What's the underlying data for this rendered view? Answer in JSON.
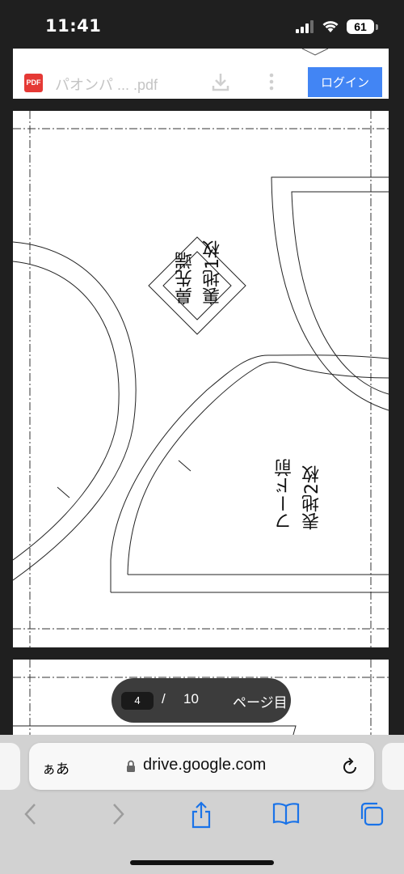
{
  "status_bar": {
    "time": "11:41",
    "battery": "61",
    "icons": [
      "signal-icon",
      "wifi-icon",
      "battery-icon"
    ]
  },
  "pdf_viewer": {
    "badge": "PDF",
    "file_name": "パオンパ ... .pdf",
    "login_label": "ログイン",
    "icons": [
      "download-icon",
      "more-icon"
    ],
    "accent_color": "#4285f4",
    "badge_color": "#e53935"
  },
  "pattern_page": {
    "labels": {
      "nose_tip": "鼻先端",
      "nose_tip_count": "裏地1枚",
      "hood_front": "フード前",
      "hood_front_count": "表地2枚"
    }
  },
  "page_indicator": {
    "current": "4",
    "separator": "/",
    "total": "10",
    "menu_label": "ページ目"
  },
  "safari": {
    "aa_label": "ぁあ",
    "url": "drive.google.com",
    "toolbar": [
      "back-icon",
      "forward-icon",
      "share-icon",
      "bookmarks-icon",
      "tabs-icon"
    ],
    "tint_color": "#1a73e8"
  }
}
